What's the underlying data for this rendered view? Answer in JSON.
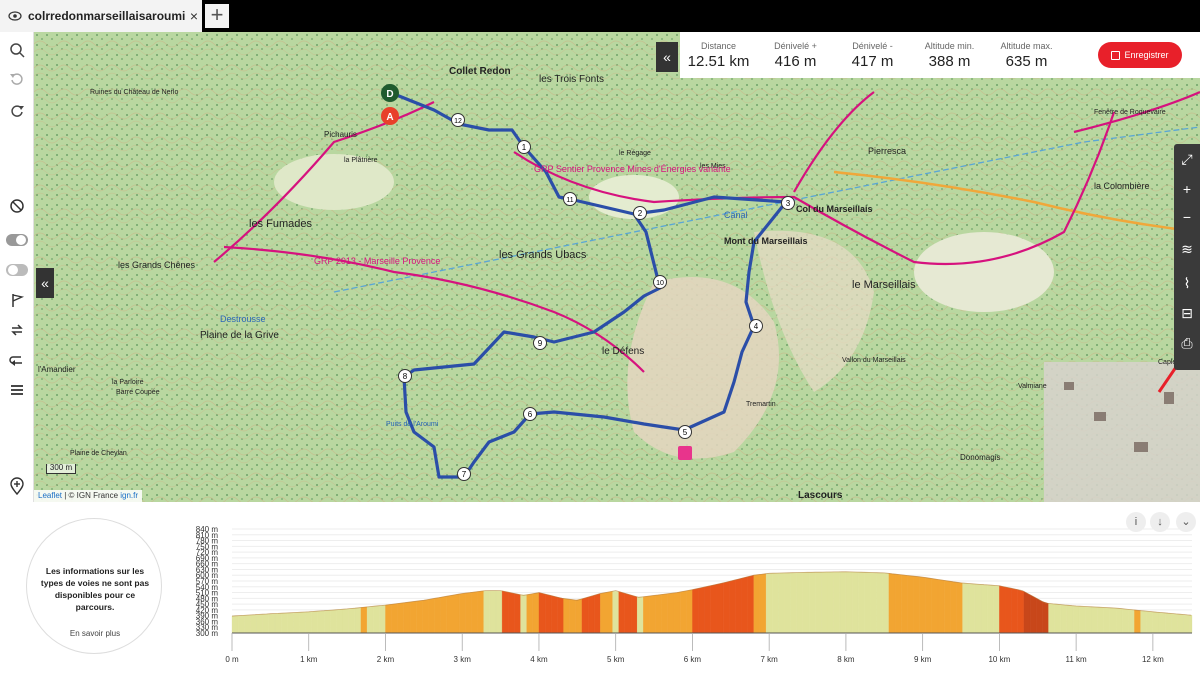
{
  "tab": {
    "title": "colrredonmarseillaisaroumi",
    "close": "×",
    "new_tab": "+"
  },
  "stats": {
    "items": [
      {
        "label": "Distance",
        "value": "12.51 km"
      },
      {
        "label": "Dénivelé +",
        "value": "416 m"
      },
      {
        "label": "Dénivelé -",
        "value": "417 m"
      },
      {
        "label": "Altitude min.",
        "value": "388 m"
      },
      {
        "label": "Altitude max.",
        "value": "635 m"
      }
    ],
    "save_label": "Enregistrer"
  },
  "map": {
    "collapse_glyph": "«",
    "scale_label": "300 m",
    "attribution_leaflet": "Leaflet",
    "attribution_sep": " | © IGN France ",
    "attribution_link": "ign.fr",
    "start_marker": "D",
    "end_marker": "A",
    "waypoints": [
      "1",
      "2",
      "3",
      "4",
      "5",
      "6",
      "7",
      "8",
      "9",
      "10",
      "11",
      "12"
    ],
    "place_labels": [
      {
        "text": "Collet Redon"
      },
      {
        "text": "les Trois Fonts"
      },
      {
        "text": "Ruines du Château de Nerlo"
      },
      {
        "text": "Pichauris"
      },
      {
        "text": "la Plâtrière"
      },
      {
        "text": "les Fumades"
      },
      {
        "text": "les Grands Ubacs"
      },
      {
        "text": "les Grands Chênes"
      },
      {
        "text": "Plaine de la Grive"
      },
      {
        "text": "l'Amandier"
      },
      {
        "text": "la Parloire"
      },
      {
        "text": "Barre Coupée"
      },
      {
        "text": "Plaine de Cheylan"
      },
      {
        "text": "le Défens"
      },
      {
        "text": "Mont du Marseillais"
      },
      {
        "text": "Col du Marseillais"
      },
      {
        "text": "le Marseillais"
      },
      {
        "text": "Pierresca"
      },
      {
        "text": "la Colombière"
      },
      {
        "text": "Fenêtre de Roquevaire"
      },
      {
        "text": "Tremartin"
      },
      {
        "text": "Lascours"
      },
      {
        "text": "Donomagis"
      },
      {
        "text": "Vallon du Marseillais"
      },
      {
        "text": "Puits de l'Aroumi"
      },
      {
        "text": "Canal"
      },
      {
        "text": "le Régage"
      },
      {
        "text": "les Mies"
      },
      {
        "text": "Destrousse"
      },
      {
        "text": "GRP Sentier Provence Mines d'Énergies variante"
      },
      {
        "text": "GRP 2013 - Marseille Provence"
      },
      {
        "text": "Valmiane"
      },
      {
        "text": "Caplen"
      }
    ]
  },
  "bottom": {
    "info_message": "Les informations sur les types de voies ne sont pas disponibles pour ce parcours.",
    "learn_more": "En savoir plus",
    "info_icon": "i",
    "download_icon": "↓",
    "expand_icon": "⌄"
  },
  "colors": {
    "route": "#2b4ea8",
    "gr_trail": "#d6127e",
    "save_button": "#e8202a",
    "start_marker": "#1f5b2e",
    "end_marker": "#e8402a"
  },
  "chart_data": {
    "type": "area",
    "title": "",
    "xlabel": "",
    "ylabel": "",
    "x_unit": "km",
    "y_unit": "m",
    "xlim": [
      0,
      12.51
    ],
    "ylim": [
      300,
      840
    ],
    "yticks": [
      "840 m",
      "810 m",
      "780 m",
      "750 m",
      "720 m",
      "690 m",
      "660 m",
      "630 m",
      "600 m",
      "570 m",
      "540 m",
      "510 m",
      "480 m",
      "450 m",
      "420 m",
      "390 m",
      "360 m",
      "330 m",
      "300 m"
    ],
    "ytick_values": [
      840,
      810,
      780,
      750,
      720,
      690,
      660,
      630,
      600,
      570,
      540,
      510,
      480,
      450,
      420,
      390,
      360,
      330,
      300
    ],
    "xticks": [
      "0 m",
      "1 km",
      "2 km",
      "3 km",
      "4 km",
      "5 km",
      "6 km",
      "7 km",
      "8 km",
      "9 km",
      "10 km",
      "11 km",
      "12 km"
    ],
    "xtick_values": [
      0,
      1,
      2,
      3,
      4,
      5,
      6,
      7,
      8,
      9,
      10,
      11,
      12
    ],
    "x": [
      0,
      0.5,
      1.0,
      1.5,
      2.0,
      2.5,
      3.0,
      3.3,
      3.5,
      3.8,
      4.0,
      4.3,
      4.5,
      4.8,
      5.0,
      5.3,
      5.5,
      5.8,
      6.0,
      6.4,
      6.8,
      7.0,
      7.5,
      8.0,
      8.5,
      9.0,
      9.5,
      10.0,
      10.3,
      10.6,
      11.0,
      11.5,
      12.0,
      12.51
    ],
    "y": [
      388,
      400,
      410,
      425,
      445,
      470,
      505,
      520,
      520,
      495,
      510,
      480,
      470,
      505,
      520,
      485,
      495,
      510,
      525,
      560,
      600,
      610,
      615,
      618,
      612,
      590,
      560,
      545,
      520,
      455,
      440,
      430,
      410,
      392
    ],
    "segment_slope_colors": [
      "#dfe39c",
      "#f2a532",
      "#e8561c",
      "#c8471a"
    ]
  }
}
